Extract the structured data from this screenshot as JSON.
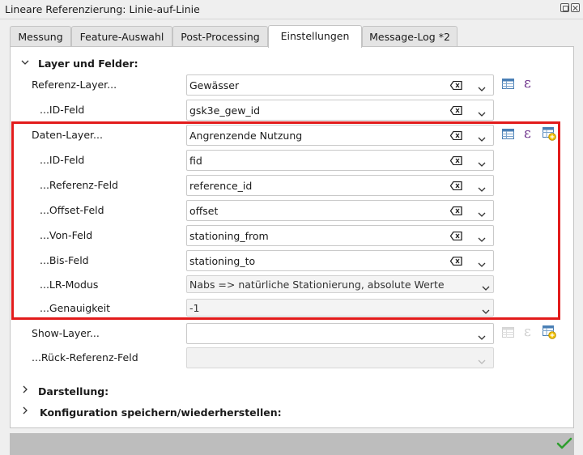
{
  "window": {
    "title": "Lineare Referenzierung: Linie-auf-Linie"
  },
  "tabs": [
    {
      "label": "Messung"
    },
    {
      "label": "Feature-Auswahl"
    },
    {
      "label": "Post-Processing"
    },
    {
      "label": "Einstellungen",
      "active": true
    },
    {
      "label": "Message-Log *2"
    }
  ],
  "sections": {
    "layers": {
      "label": "Layer und Felder:",
      "expanded": true
    },
    "display": {
      "label": "Darstellung:",
      "expanded": false
    },
    "config": {
      "label": "Konfiguration speichern/wiederherstellen:",
      "expanded": false
    }
  },
  "rows": {
    "ref_layer": {
      "label": "Referenz-Layer...",
      "value": "Gewässer"
    },
    "ref_id": {
      "label": "...ID-Feld",
      "value": "gsk3e_gew_id"
    },
    "data_layer": {
      "label": "Daten-Layer...",
      "value": "Angrenzende Nutzung"
    },
    "data_id": {
      "label": "...ID-Feld",
      "value": "fid"
    },
    "ref_field": {
      "label": "...Referenz-Feld",
      "value": "reference_id"
    },
    "offset_field": {
      "label": "...Offset-Feld",
      "value": "offset"
    },
    "from_field": {
      "label": "...Von-Feld",
      "value": "stationing_from"
    },
    "to_field": {
      "label": "...Bis-Feld",
      "value": "stationing_to"
    },
    "lr_mode": {
      "label": "...LR-Modus",
      "value": "Nabs => natürliche Stationierung, absolute Werte"
    },
    "precision": {
      "label": "...Genauigkeit",
      "value": "-1"
    },
    "show_layer": {
      "label": "Show-Layer...",
      "value": ""
    },
    "back_ref": {
      "label": "...Rück-Referenz-Feld",
      "value": ""
    }
  },
  "icons": {
    "table": "attribute-table-icon",
    "expression": "expression-epsilon-icon",
    "new_layer": "create-layer-icon",
    "clear": "clear-field-icon",
    "dropdown": "chevron-down-icon",
    "ok": "checkmark-icon"
  },
  "colors": {
    "highlight": "#e21b1b",
    "epsilon": "#6b2f8a",
    "ok": "#2e9e2e"
  }
}
